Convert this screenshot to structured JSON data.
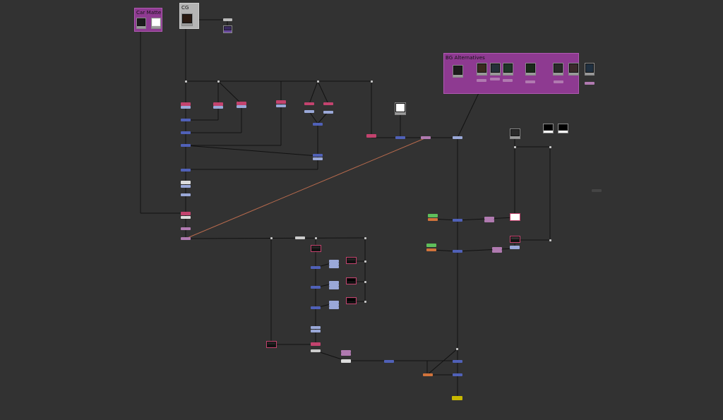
{
  "app": {
    "view": "node-graph"
  },
  "backdrops": {
    "car_matte": {
      "label": "Car Matte",
      "color": "#8e3a91"
    },
    "cg": {
      "label": "CG",
      "color": "#b4b4b4"
    },
    "bg_alternatives": {
      "label": "BG Alternatives",
      "color": "#8e3a91"
    }
  },
  "colors": {
    "merge": "#5061b8",
    "grade": "#c3436e",
    "shuffle": "#9aa8d8",
    "dot": "#c8c8c8",
    "write": "#c8b800",
    "constant_green": "#5fbf5b",
    "constant_orange": "#d1733b",
    "transform": "#b07ab0",
    "wire": "#111111",
    "highlight_wire": "#b86a4d"
  },
  "icons": {
    "read": "read-thumbnail-icon",
    "dot": "dot-node-icon",
    "write": "write-node-icon"
  }
}
